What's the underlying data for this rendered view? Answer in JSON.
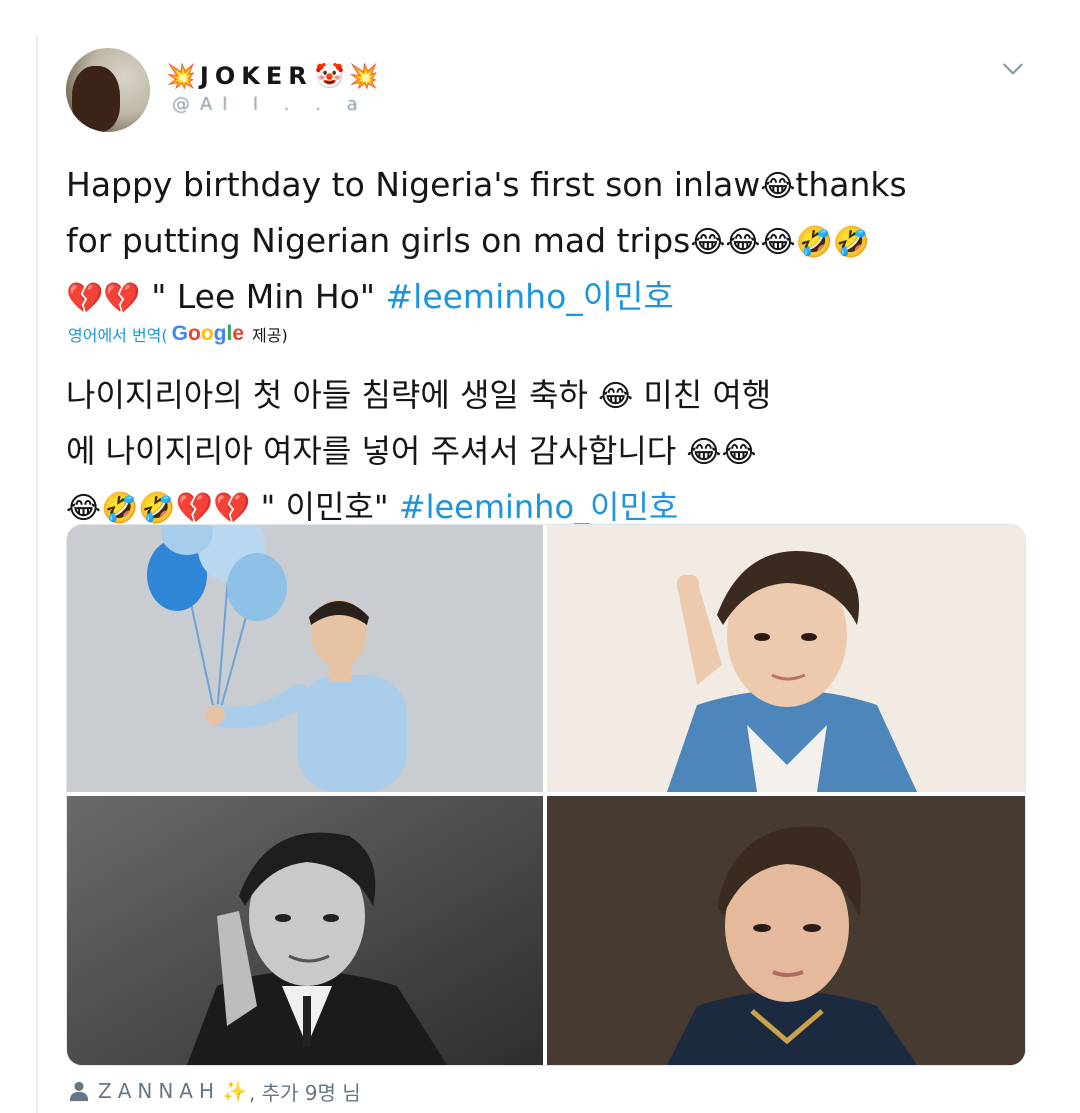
{
  "user": {
    "display_name": "JOKER",
    "prefix_emoji": "💥",
    "suffix_emoji": "🤡",
    "trailing_emoji": "💥",
    "handle": "@Al  l    .   . a",
    "menu_icon": "chevron-down-icon"
  },
  "tweet": {
    "text_line1": "Happy birthday to Nigeria's first son inlaw",
    "text_line1_emoji": "😂",
    "text_line1_tail": "thanks",
    "text_line2": "for putting Nigerian girls on mad trips",
    "text_line2_emoji": "😂😂😂🤣🤣",
    "text_line3_emoji": "💔💔",
    "text_line3": " \" Lee Min Ho\" ",
    "hashtag": "#leeminho_이민호"
  },
  "translation": {
    "label": "영어에서 번역(",
    "provider_g1": "G",
    "provider_o1": "o",
    "provider_o2": "o",
    "provider_g2": "g",
    "provider_l": "l",
    "provider_e": "e",
    "suffix": "제공)"
  },
  "translated": {
    "line1": "나이지리아의 첫 아들 침략에 생일 축하 ",
    "line1_emoji": "😂",
    "line1_tail": " 미친 여행",
    "line2": "에 나이지리아 여자를 넣어 주셔서 감사합니다 ",
    "line2_emoji": "😂😂",
    "line3_emoji": "😂🤣🤣💔💔",
    "line3": " \" 이민호\" ",
    "hashtag": "#leeminho_이민호"
  },
  "footer": {
    "icon": "person-icon",
    "names": "ZANNAH",
    "sparkle": "✨",
    "suffix": ", 추가 9명 님"
  },
  "colors": {
    "link": "#1b95e0",
    "secondary_text": "#657786",
    "border": "#e1e8ed"
  }
}
